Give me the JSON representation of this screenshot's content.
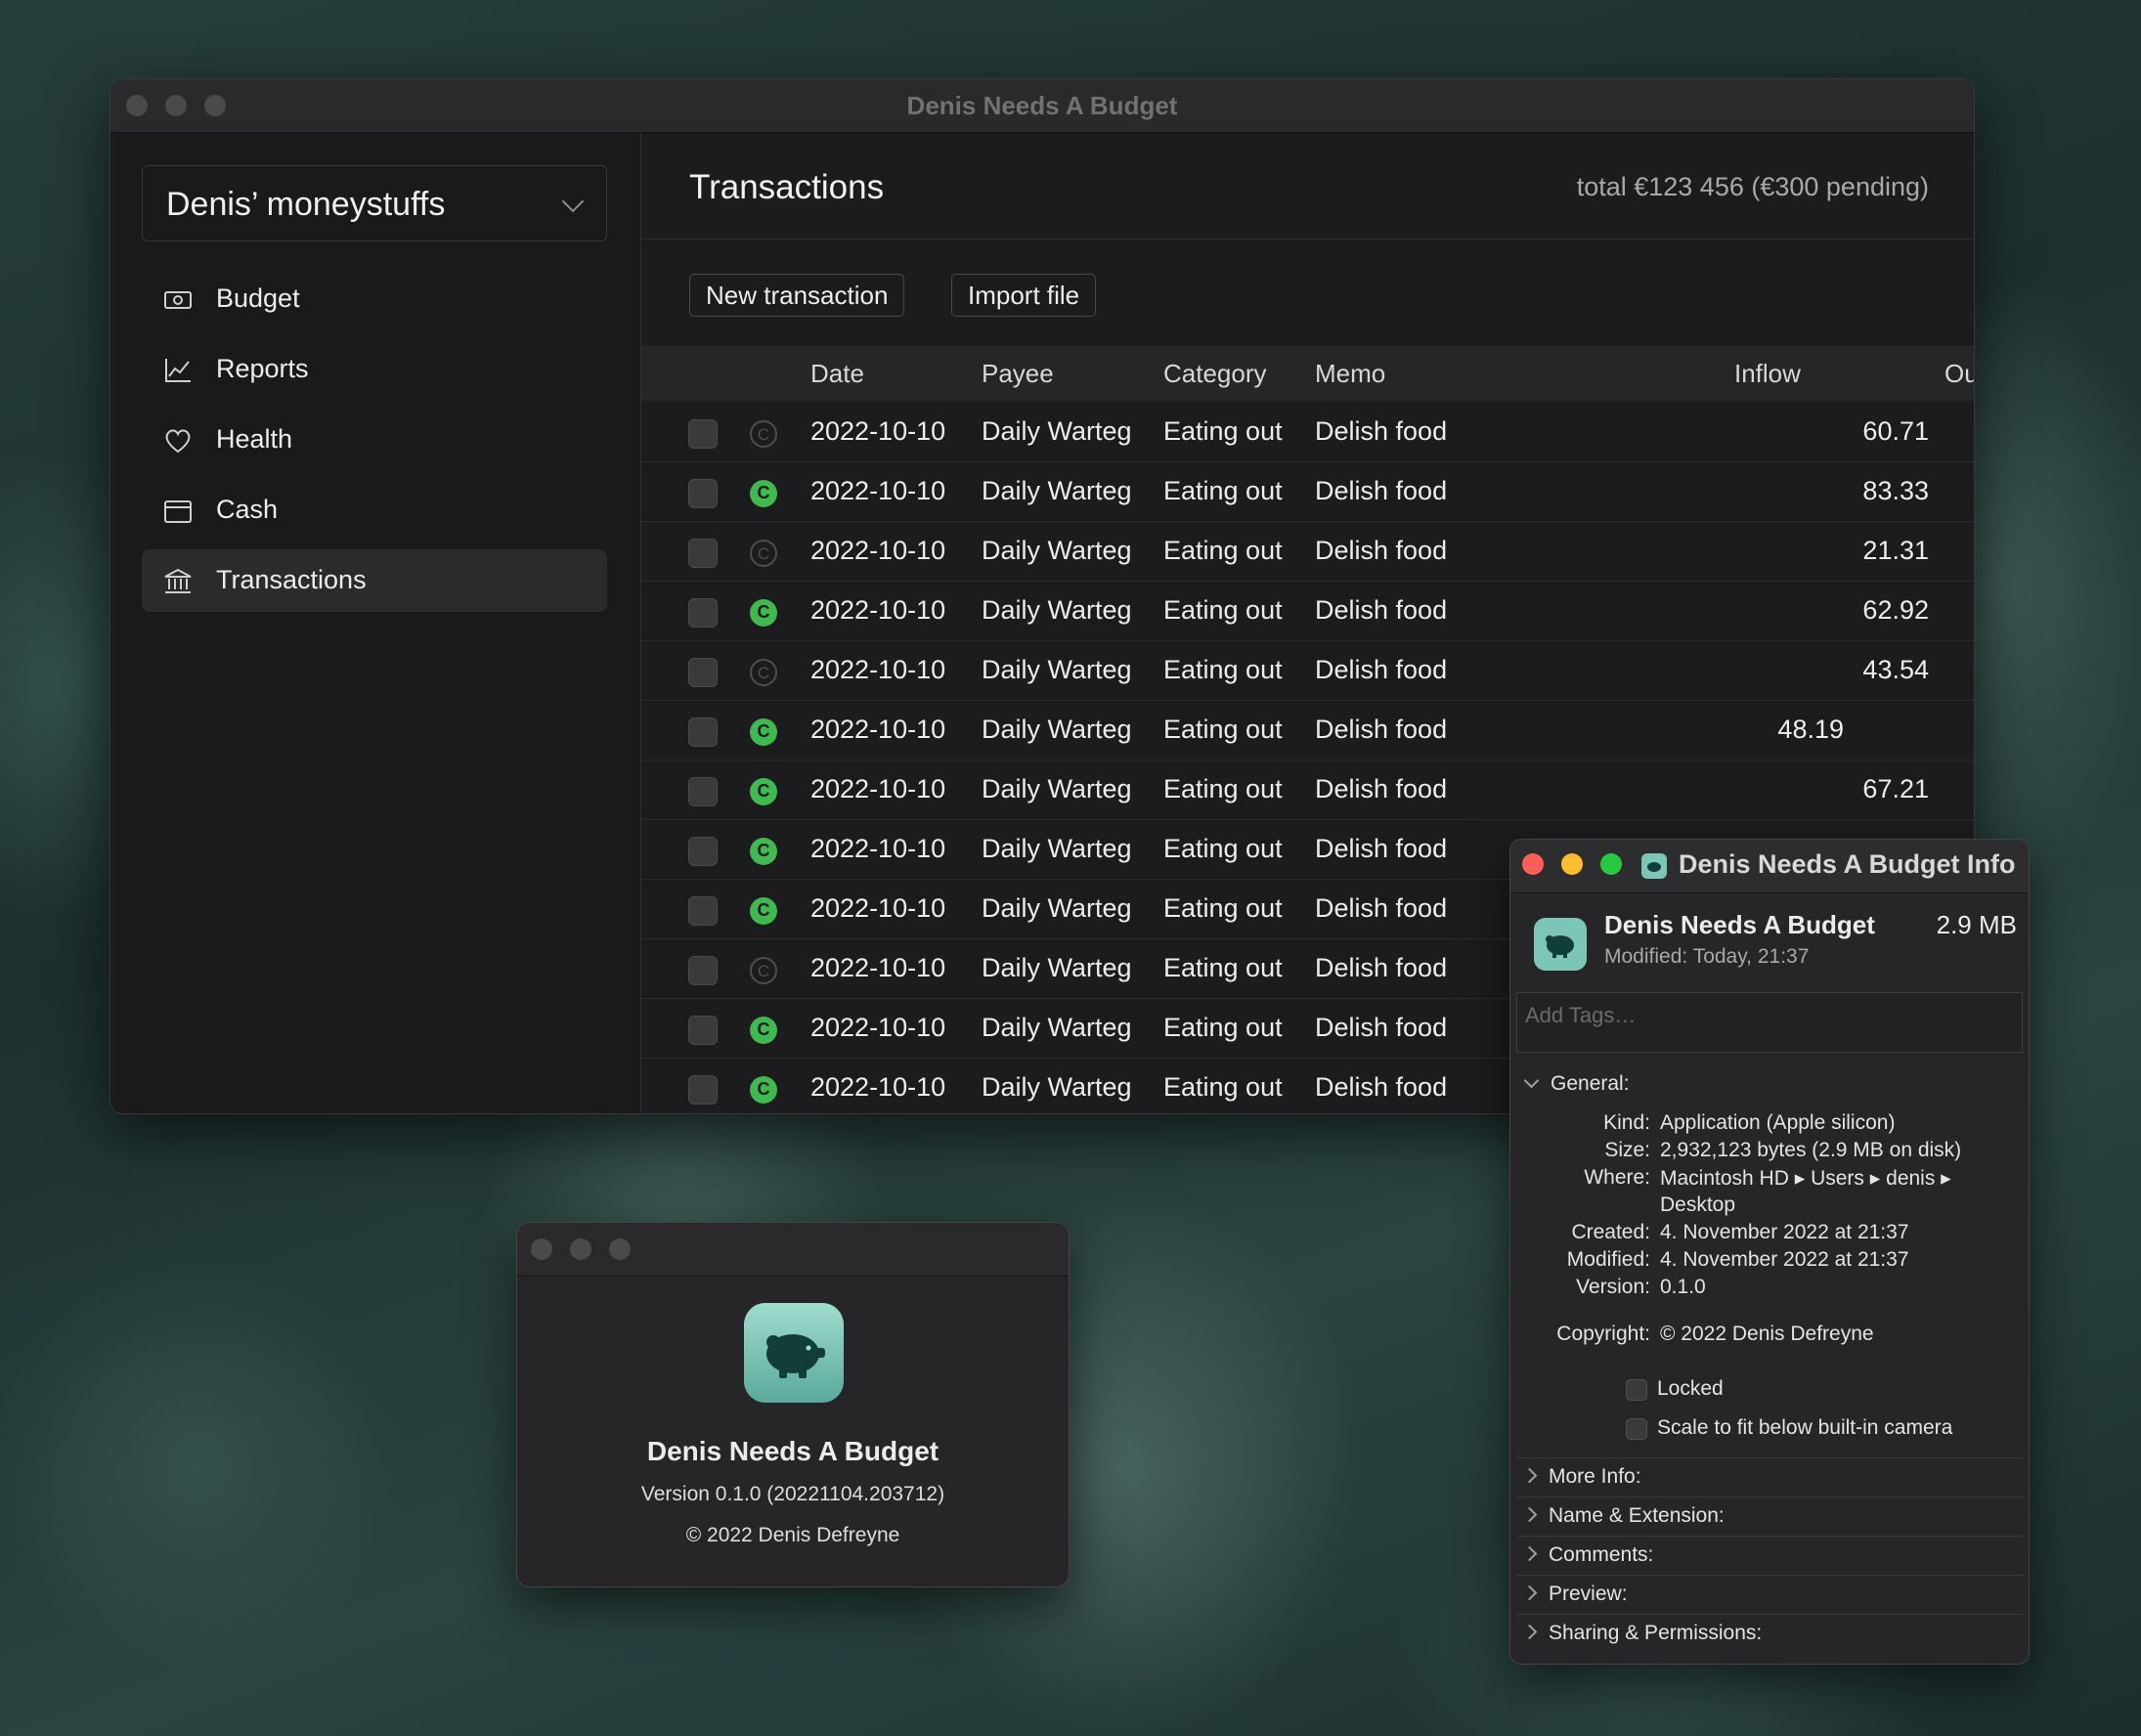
{
  "main_window": {
    "title": "Denis Needs A Budget",
    "account_name": "Denis’ moneystuffs",
    "nav": [
      {
        "label": "Budget",
        "icon": "money-icon"
      },
      {
        "label": "Reports",
        "icon": "chart-icon"
      },
      {
        "label": "Health",
        "icon": "heart-icon"
      },
      {
        "label": "Cash",
        "icon": "wallet-icon"
      },
      {
        "label": "Transactions",
        "icon": "bank-icon",
        "active": true
      }
    ],
    "page_title": "Transactions",
    "total": "total €123 456 (€300 pending)",
    "buttons": {
      "new": "New transaction",
      "import": "Import file"
    },
    "columns": [
      "Date",
      "Payee",
      "Category",
      "Memo",
      "Inflow",
      "Outflow"
    ],
    "cleared_glyph": "C",
    "rows": [
      {
        "cleared": false,
        "date": "2022-10-10",
        "payee": "Daily Warteg",
        "category": "Eating out",
        "memo": "Delish food",
        "inflow": "",
        "outflow": "60.71"
      },
      {
        "cleared": true,
        "date": "2022-10-10",
        "payee": "Daily Warteg",
        "category": "Eating out",
        "memo": "Delish food",
        "inflow": "",
        "outflow": "83.33"
      },
      {
        "cleared": false,
        "date": "2022-10-10",
        "payee": "Daily Warteg",
        "category": "Eating out",
        "memo": "Delish food",
        "inflow": "",
        "outflow": "21.31"
      },
      {
        "cleared": true,
        "date": "2022-10-10",
        "payee": "Daily Warteg",
        "category": "Eating out",
        "memo": "Delish food",
        "inflow": "",
        "outflow": "62.92"
      },
      {
        "cleared": false,
        "date": "2022-10-10",
        "payee": "Daily Warteg",
        "category": "Eating out",
        "memo": "Delish food",
        "inflow": "",
        "outflow": "43.54"
      },
      {
        "cleared": true,
        "date": "2022-10-10",
        "payee": "Daily Warteg",
        "category": "Eating out",
        "memo": "Delish food",
        "inflow": "48.19",
        "outflow": ""
      },
      {
        "cleared": true,
        "date": "2022-10-10",
        "payee": "Daily Warteg",
        "category": "Eating out",
        "memo": "Delish food",
        "inflow": "",
        "outflow": "67.21"
      },
      {
        "cleared": true,
        "date": "2022-10-10",
        "payee": "Daily Warteg",
        "category": "Eating out",
        "memo": "Delish food",
        "inflow": "",
        "outflow": ""
      },
      {
        "cleared": true,
        "date": "2022-10-10",
        "payee": "Daily Warteg",
        "category": "Eating out",
        "memo": "Delish food",
        "inflow": "",
        "outflow": ""
      },
      {
        "cleared": false,
        "date": "2022-10-10",
        "payee": "Daily Warteg",
        "category": "Eating out",
        "memo": "Delish food",
        "inflow": "",
        "outflow": ""
      },
      {
        "cleared": true,
        "date": "2022-10-10",
        "payee": "Daily Warteg",
        "category": "Eating out",
        "memo": "Delish food",
        "inflow": "",
        "outflow": ""
      },
      {
        "cleared": true,
        "date": "2022-10-10",
        "payee": "Daily Warteg",
        "category": "Eating out",
        "memo": "Delish food",
        "inflow": "",
        "outflow": ""
      }
    ]
  },
  "about_window": {
    "app_name": "Denis Needs A Budget",
    "version": "Version 0.1.0 (20221104.203712)",
    "copyright": "© 2022 Denis Defreyne"
  },
  "info_window": {
    "title": "Denis Needs A Budget Info",
    "name": "Denis Needs A Budget",
    "size": "2.9 MB",
    "modified_label": "Modified:",
    "modified_value": "Today, 21:37",
    "tags_placeholder": "Add Tags…",
    "general_label": "General:",
    "general": [
      {
        "key": "Kind:",
        "value": "Application (Apple silicon)"
      },
      {
        "key": "Size:",
        "value": "2,932,123 bytes (2.9 MB on disk)"
      },
      {
        "key": "Where:",
        "value": "Macintosh HD ▸ Users ▸ denis ▸"
      },
      {
        "key": "",
        "value": "Desktop"
      },
      {
        "key": "Created:",
        "value": "4. November 2022 at 21:37"
      },
      {
        "key": "Modified:",
        "value": "4. November 2022 at 21:37"
      },
      {
        "key": "Version:",
        "value": "0.1.0"
      }
    ],
    "copyright_key": "Copyright:",
    "copyright_value": "© 2022 Denis Defreyne",
    "checkboxes": [
      "Locked",
      "Scale to fit below built-in camera"
    ],
    "sections": [
      "More Info:",
      "Name & Extension:",
      "Comments:",
      "Preview:",
      "Sharing & Permissions:"
    ]
  },
  "colors": {
    "cleared_green": "#3fb950",
    "close_red": "#fe5f57",
    "minimize_yellow": "#febc2e",
    "zoom_green": "#28c840",
    "app_icon_teal": "#7cc6b8"
  }
}
